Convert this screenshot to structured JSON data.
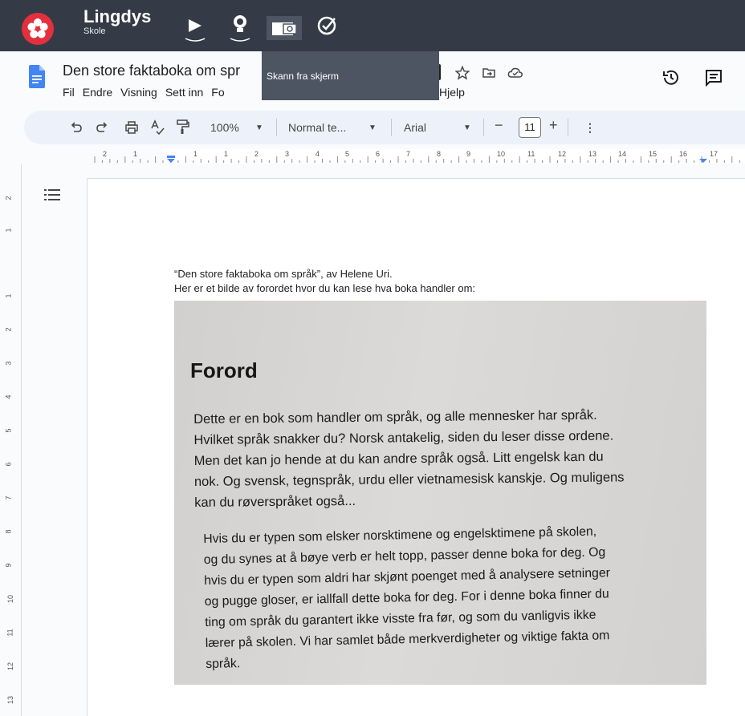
{
  "lingdys": {
    "name": "Lingdys",
    "subtitle": "Skole",
    "buttons": [
      "play-icon",
      "lightbulb-icon",
      "camera-icon",
      "check-circle-icon"
    ],
    "tooltip": "Skann fra skjerm",
    "brand_color": "#e3303c",
    "bar_color": "#343b46"
  },
  "doc": {
    "title": "Den store faktaboka om spr",
    "menu": [
      "Fil",
      "Endre",
      "Visning",
      "Sett inn",
      "Fo"
    ],
    "menu_tail": "Hjelp"
  },
  "toolbar": {
    "zoom": "100%",
    "style": "Normal te...",
    "font": "Arial",
    "font_size": "11"
  },
  "ruler": {
    "h_numbers": [
      "2",
      "1",
      "1",
      "1",
      "2",
      "3",
      "4",
      "5",
      "6",
      "7",
      "8",
      "9",
      "10",
      "11",
      "12",
      "13",
      "14",
      "15",
      "16",
      "17"
    ],
    "v_numbers": [
      "2",
      "1",
      "1",
      "2",
      "3",
      "4",
      "5",
      "6",
      "7",
      "8",
      "9",
      "10",
      "11",
      "12",
      "13"
    ]
  },
  "body": {
    "line1": "“Den store faktaboka om språk”, av Helene Uri.",
    "line2": "Her er et bilde av forordet hvor du kan lese hva boka handler om:"
  },
  "photo": {
    "heading": "Forord",
    "para1": [
      "Dette er en bok som handler om språk, og alle mennesker har språk.",
      "Hvilket språk snakker du? Norsk antakelig, siden du leser disse ordene.",
      "Men det kan jo hende at du kan andre språk også. Litt engelsk kan du",
      "nok. Og svensk, tegnspråk, urdu eller vietnamesisk kanskje. Og muligens",
      "kan du røverspråket også..."
    ],
    "para2": [
      "Hvis du er typen som elsker norsktimene og engelsktimene på skolen,",
      "og du synes at å bøye verb er helt topp, passer denne boka for deg. Og",
      "hvis du er typen som aldri har skjønt poenget med å analysere setninger",
      "og pugge gloser, er iallfall dette boka for deg. For i denne boka finner du",
      "ting om språk du garantert ikke visste fra før, og som du vanligvis ikke",
      "lærer på skolen. Vi har samlet både merkverdigheter og viktige fakta om",
      "språk."
    ]
  }
}
